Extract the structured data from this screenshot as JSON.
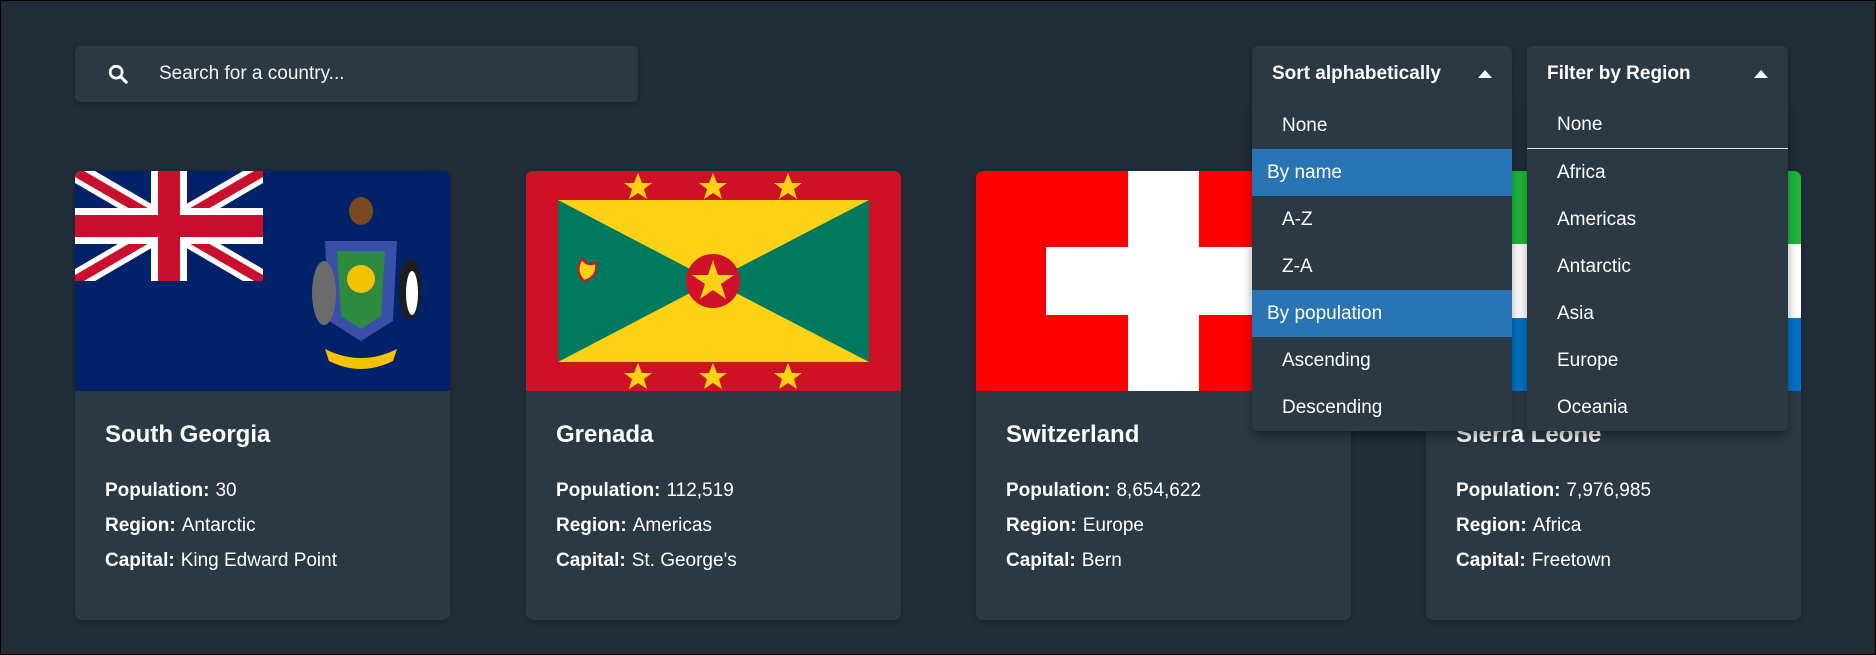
{
  "search": {
    "placeholder": "Search for a country..."
  },
  "sort": {
    "label": "Sort alphabetically",
    "options": {
      "none": "None",
      "by_name": "By name",
      "az": "A-Z",
      "za": "Z-A",
      "by_population": "By population",
      "ascending": "Ascending",
      "descending": "Descending"
    }
  },
  "filter": {
    "label": "Filter by Region",
    "options": [
      "None",
      "Africa",
      "Americas",
      "Antarctic",
      "Asia",
      "Europe",
      "Oceania"
    ]
  },
  "field_labels": {
    "population": "Population:",
    "region": "Region:",
    "capital": "Capital:"
  },
  "countries": [
    {
      "name": "South Georgia",
      "population": "30",
      "region": "Antarctic",
      "capital": "King Edward Point"
    },
    {
      "name": "Grenada",
      "population": "112,519",
      "region": "Americas",
      "capital": "St. George's"
    },
    {
      "name": "Switzerland",
      "population": "8,654,622",
      "region": "Europe",
      "capital": "Bern"
    },
    {
      "name": "Sierra Leone",
      "population": "7,976,985",
      "region": "Africa",
      "capital": "Freetown"
    }
  ],
  "colors": {
    "background": "#202c37",
    "element": "#2b3945",
    "highlight": "#2874b4"
  },
  "icons": {
    "search": "search-icon",
    "caret": "caret-up-icon"
  }
}
